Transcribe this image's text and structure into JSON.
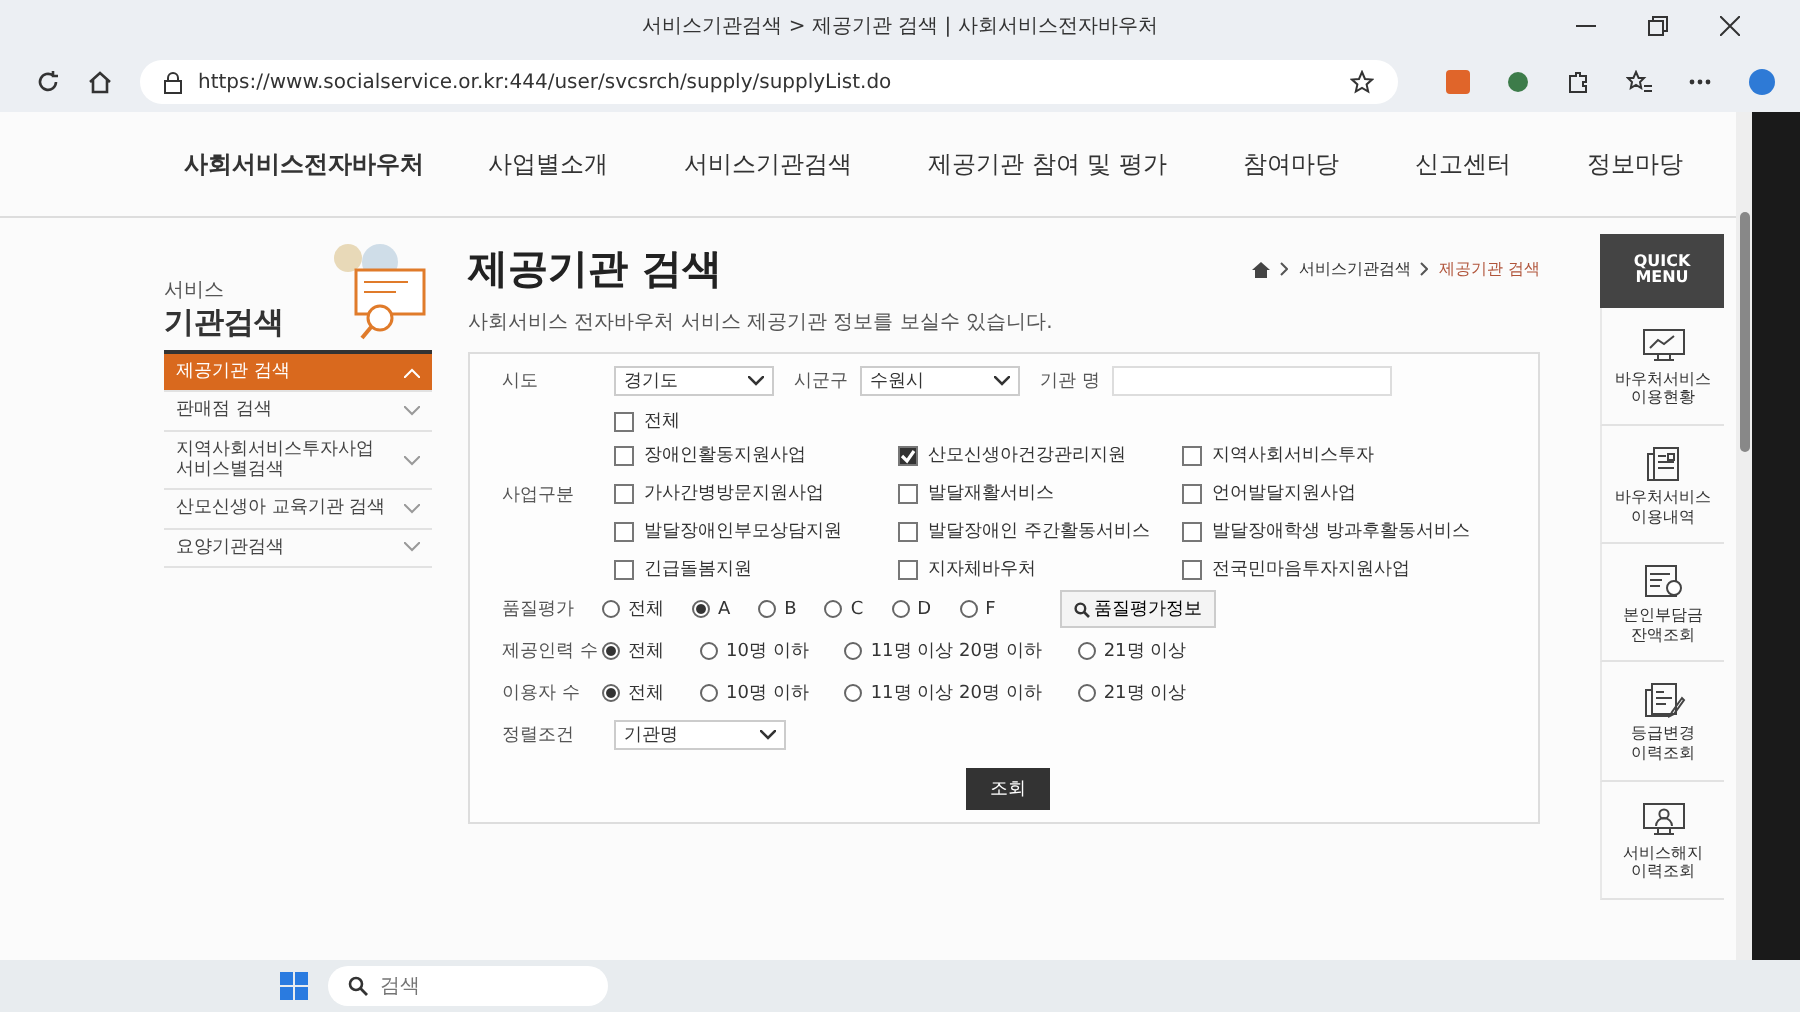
{
  "window": {
    "title": "서비스기관검색 > 제공기관 검색 | 사회서비스전자바우처"
  },
  "address_bar": {
    "url": "https://www.socialservice.or.kr:444/user/svcsrch/supply/supplyList.do"
  },
  "nav": [
    "사회서비스전자바우처",
    "사업별소개",
    "서비스기관검색",
    "제공기관 참여 및 평가",
    "참여마당",
    "신고센터",
    "정보마당"
  ],
  "sidebar": {
    "caption": "서비스",
    "title": "기관검색",
    "items": [
      {
        "label": "제공기관 검색",
        "selected": true
      },
      {
        "label": "판매점 검색",
        "selected": false
      },
      {
        "label": "지역사회서비스투자사업\n서비스별검색",
        "selected": false
      },
      {
        "label": "산모신생아 교육기관 검색",
        "selected": false
      },
      {
        "label": "요양기관검색",
        "selected": false
      }
    ]
  },
  "page": {
    "title": "제공기관 검색",
    "breadcrumb": [
      "서비스기관검색",
      "제공기관 검색"
    ],
    "subtitle": "사회서비스 전자바우처 서비스 제공기관 정보를 보실수 있습니다."
  },
  "form": {
    "region": {
      "label": "시도",
      "value": "경기도"
    },
    "district": {
      "label": "시군구",
      "value": "수원시"
    },
    "agency_name": {
      "label": "기관 명"
    },
    "business_label": "사업구분",
    "business_all": {
      "label": "전체",
      "checked": false
    },
    "business_types": [
      {
        "label": "장애인활동지원사업",
        "checked": false
      },
      {
        "label": "산모신생아건강관리지원",
        "checked": true
      },
      {
        "label": "지역사회서비스투자",
        "checked": false
      },
      {
        "label": "가사간병방문지원사업",
        "checked": false
      },
      {
        "label": "발달재활서비스",
        "checked": false
      },
      {
        "label": "언어발달지원사업",
        "checked": false
      },
      {
        "label": "발달장애인부모상담지원",
        "checked": false
      },
      {
        "label": "발달장애인 주간활동서비스",
        "checked": false
      },
      {
        "label": "발달장애학생 방과후활동서비스",
        "checked": false
      },
      {
        "label": "긴급돌봄지원",
        "checked": false
      },
      {
        "label": "지자체바우처",
        "checked": false
      },
      {
        "label": "전국민마음투자지원사업",
        "checked": false
      }
    ],
    "radio_groups": [
      {
        "label": "품질평가",
        "options": [
          {
            "label": "전체",
            "selected": false
          },
          {
            "label": "A",
            "selected": true
          },
          {
            "label": "B",
            "selected": false
          },
          {
            "label": "C",
            "selected": false
          },
          {
            "label": "D",
            "selected": false
          },
          {
            "label": "F",
            "selected": false
          }
        ],
        "button": "품질평가정보"
      },
      {
        "label": "제공인력 수",
        "options": [
          {
            "label": "전체",
            "selected": true
          },
          {
            "label": "10명 이하",
            "selected": false
          },
          {
            "label": "11명 이상 20명 이하",
            "selected": false
          },
          {
            "label": "21명 이상",
            "selected": false
          }
        ]
      },
      {
        "label": "이용자 수",
        "options": [
          {
            "label": "전체",
            "selected": true
          },
          {
            "label": "10명 이하",
            "selected": false
          },
          {
            "label": "11명 이상 20명 이하",
            "selected": false
          },
          {
            "label": "21명 이상",
            "selected": false
          }
        ]
      }
    ],
    "sort": {
      "label": "정렬조건",
      "value": "기관명"
    },
    "submit": "조회"
  },
  "quick_menu": {
    "title": "QUICK\nMENU",
    "items": [
      {
        "kind": "monitor",
        "label": "바우처서비스\n이용현황"
      },
      {
        "kind": "document",
        "label": "바우처서비스\n이용내역"
      },
      {
        "kind": "search",
        "label": "본인부담금\n잔액조회"
      },
      {
        "kind": "edit",
        "label": "등급변경\n이력조회"
      },
      {
        "kind": "person",
        "label": "서비스해지\n이력조회"
      }
    ]
  },
  "taskbar": {
    "search_placeholder": "검색"
  }
}
